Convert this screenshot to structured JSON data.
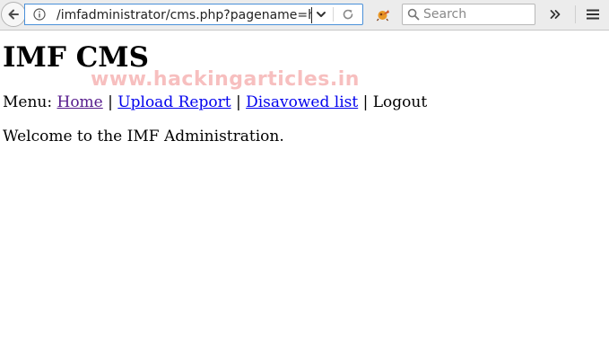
{
  "browser": {
    "url": "/imfadministrator/cms.php?pagename=home",
    "search_placeholder": "Search",
    "icons": {
      "back": "back-arrow-icon",
      "info": "info-icon",
      "dropdown": "chevron-down-icon",
      "reload": "reload-icon",
      "extension": "extension-icon",
      "search": "search-icon",
      "overflow": "double-chevron-right-icon",
      "menu": "hamburger-menu-icon"
    }
  },
  "page": {
    "title": "IMF CMS",
    "watermark": "www.hackingarticles.in",
    "menu": {
      "prefix": "Menu:",
      "separator": "|",
      "items": [
        {
          "label": "Home",
          "visited": true
        },
        {
          "label": "Upload Report",
          "visited": false
        },
        {
          "label": "Disavowed list",
          "visited": false
        },
        {
          "label": "Logout",
          "link": false
        }
      ]
    },
    "welcome": "Welcome to the IMF Administration."
  },
  "colors": {
    "link": "#0000ee",
    "visited_link": "#551a8b",
    "url_focus_border": "#4a90d9",
    "watermark": "#f18a8a",
    "toolbar_bg": "#ececec"
  }
}
